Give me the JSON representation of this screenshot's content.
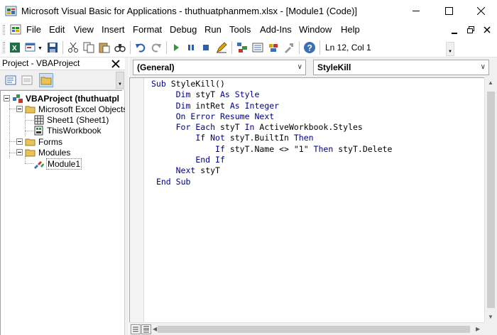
{
  "window": {
    "title": "Microsoft Visual Basic for Applications - thuthuatphanmem.xlsx - [Module1 (Code)]"
  },
  "menu": {
    "items": [
      {
        "label": "File"
      },
      {
        "label": "Edit"
      },
      {
        "label": "View"
      },
      {
        "label": "Insert"
      },
      {
        "label": "Format"
      },
      {
        "label": "Debug"
      },
      {
        "label": "Run"
      },
      {
        "label": "Tools"
      },
      {
        "label": "Add-Ins"
      },
      {
        "label": "Window"
      },
      {
        "label": "Help"
      }
    ]
  },
  "toolbar": {
    "status": "Ln 12, Col 1"
  },
  "project": {
    "title": "Project - VBAProject",
    "tree": {
      "root": "VBAProject (thuthuatpl",
      "excel_objects": "Microsoft Excel Objects",
      "sheet1": "Sheet1 (Sheet1)",
      "thisworkbook": "ThisWorkbook",
      "forms": "Forms",
      "modules": "Modules",
      "module1": "Module1"
    }
  },
  "code": {
    "object_combo": "(General)",
    "procedure_combo": "StyleKill",
    "lines": [
      "Sub StyleKill()",
      "     Dim styT As Style",
      "     Dim intRet As Integer",
      "     On Error Resume Next",
      "     For Each styT In ActiveWorkbook.Styles",
      "         If Not styT.BuiltIn Then",
      "             If styT.Name <> \"1\" Then styT.Delete",
      "         End If",
      "     Next styT",
      " End Sub"
    ]
  },
  "colors": {
    "keyword": "#00008b",
    "background": "#ffffff",
    "chrome": "#f0f0f0"
  }
}
